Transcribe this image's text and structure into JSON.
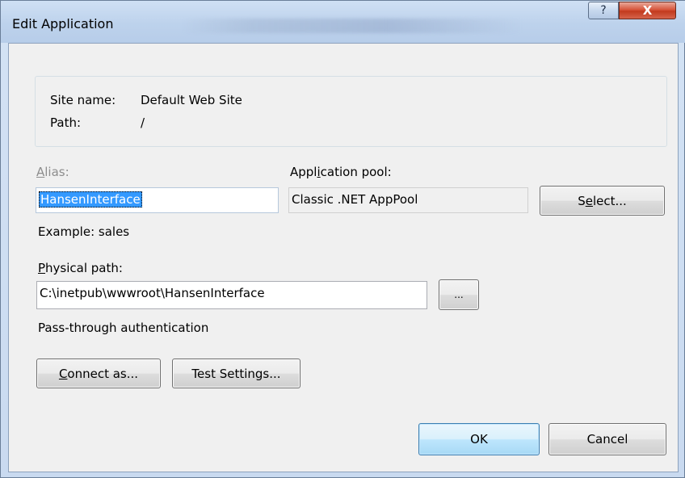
{
  "window": {
    "title": "Edit Application",
    "help_glyph": "?",
    "close_glyph": "X"
  },
  "site": {
    "name_label": "Site name:",
    "name_value": "Default Web Site",
    "path_label": "Path:",
    "path_value": "/"
  },
  "alias": {
    "label_prefix": "",
    "label_access": "A",
    "label_rest": "lias:",
    "value": "HansenInterface",
    "example": "Example: sales"
  },
  "app_pool": {
    "label_prefix": "Appl",
    "label_access": "i",
    "label_rest": "cation pool:",
    "value": "Classic .NET AppPool",
    "select_prefix": "S",
    "select_access": "e",
    "select_rest": "lect..."
  },
  "physical_path": {
    "label_prefix": "",
    "label_access": "P",
    "label_rest": "hysical path:",
    "value": "C:\\inetpub\\wwwroot\\HansenInterface",
    "browse_label": "..."
  },
  "auth": {
    "label": "Pass-through authentication",
    "connect_prefix": "",
    "connect_access": "C",
    "connect_rest": "onnect as...",
    "test_label": "Test Settings..."
  },
  "footer": {
    "ok_label": "OK",
    "cancel_label": "Cancel"
  }
}
